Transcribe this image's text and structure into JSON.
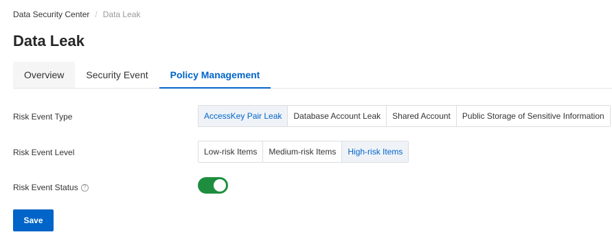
{
  "breadcrumb": {
    "items": [
      "Data Security Center",
      "Data Leak"
    ],
    "separator": "/"
  },
  "page_title": "Data Leak",
  "tabs": [
    {
      "label": "Overview",
      "active": false
    },
    {
      "label": "Security Event",
      "active": false
    },
    {
      "label": "Policy Management",
      "active": true
    }
  ],
  "form": {
    "risk_event_type": {
      "label": "Risk Event Type",
      "options": [
        {
          "label": "AccessKey Pair Leak",
          "selected": true
        },
        {
          "label": "Database Account Leak",
          "selected": false
        },
        {
          "label": "Shared Account",
          "selected": false
        },
        {
          "label": "Public Storage of Sensitive Information",
          "selected": false
        }
      ]
    },
    "risk_event_level": {
      "label": "Risk Event Level",
      "options": [
        {
          "label": "Low-risk Items",
          "selected": false
        },
        {
          "label": "Medium-risk Items",
          "selected": false
        },
        {
          "label": "High-risk Items",
          "selected": true
        }
      ]
    },
    "risk_event_status": {
      "label": "Risk Event Status",
      "help_icon": "question-circle-icon",
      "enabled": true
    }
  },
  "save_button": {
    "label": "Save"
  },
  "colors": {
    "primary": "#0064c8",
    "toggle_on": "#1e8e3e",
    "selected_bg": "#eff3f8"
  }
}
